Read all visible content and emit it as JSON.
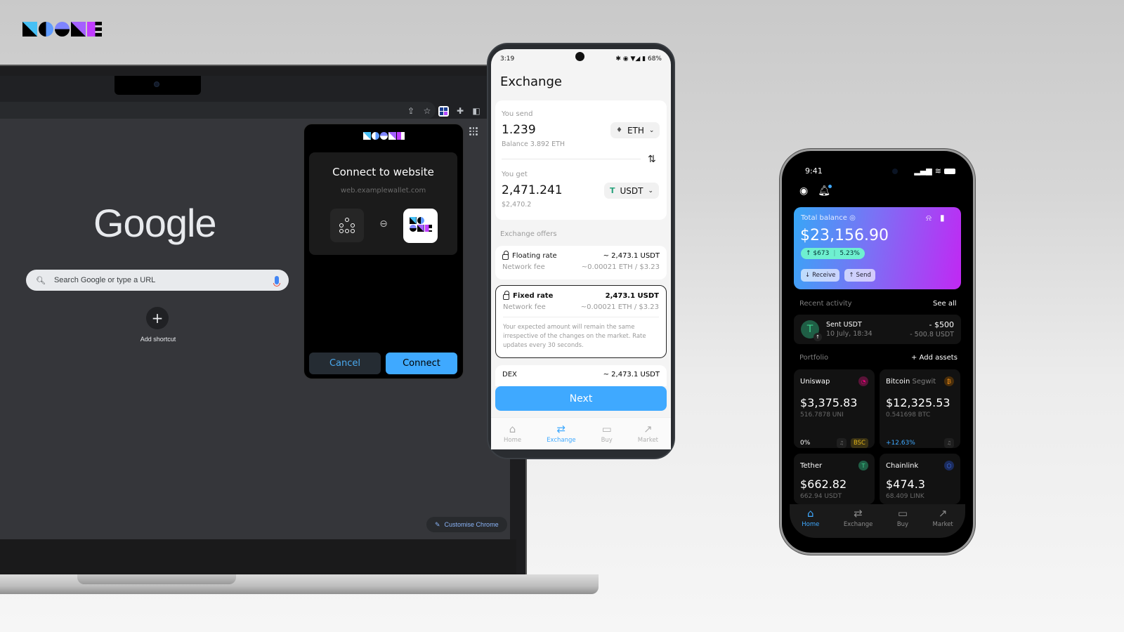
{
  "brand": {
    "name": "NOONE"
  },
  "browser": {
    "toolbar_icons": [
      "share-icon",
      "bookmark-star-icon",
      "noone-extension-icon",
      "extensions-puzzle-icon",
      "side-panel-icon",
      "profile-avatar"
    ],
    "new_tab": {
      "logo_text": "Google",
      "search_placeholder": "Search Google or type a URL",
      "add_shortcut_label": "Add shortcut",
      "customise_label": "Customise Chrome"
    }
  },
  "popup": {
    "title": "Connect to website",
    "url": "web.examplewallet.com",
    "cancel_label": "Cancel",
    "connect_label": "Connect"
  },
  "android": {
    "status": {
      "time": "3:19",
      "battery": "68%"
    },
    "title": "Exchange",
    "send": {
      "label": "You send",
      "amount": "1.239",
      "balance": "Balance 3.892 ETH",
      "token": "ETH"
    },
    "get": {
      "label": "You get",
      "amount": "2,471.241",
      "usd": "$2,470.2",
      "token": "USDT"
    },
    "offers_label": "Exchange offers",
    "offers": [
      {
        "name": "Floating rate",
        "amount": "~ 2,473.1 USDT",
        "fee_label": "Network fee",
        "fee": "~0.00021 ETH / $3.23"
      },
      {
        "name": "Fixed rate",
        "amount": "2,473.1 USDT",
        "fee_label": "Network fee",
        "fee": "~0.00021 ETH / $3.23",
        "note": "Your expected amount will remain the same irrespective of the changes on the market. Rate updates every 30 seconds."
      },
      {
        "name": "DEX",
        "amount": "~ 2,473.1 USDT"
      }
    ],
    "next_label": "Next",
    "nav": [
      {
        "label": "Home",
        "icon": "home-icon"
      },
      {
        "label": "Exchange",
        "icon": "exchange-icon",
        "active": true
      },
      {
        "label": "Buy",
        "icon": "card-icon"
      },
      {
        "label": "Market",
        "icon": "market-chart-icon"
      }
    ]
  },
  "iphone": {
    "status": {
      "time": "9:41"
    },
    "balance": {
      "label": "Total balance",
      "value": "$23,156.90",
      "change_amount": "↑ $673",
      "change_pct": "5.23%",
      "receive_label": "Receive",
      "send_label": "Send"
    },
    "recent_activity": {
      "label": "Recent activity",
      "see_all": "See all",
      "item": {
        "title": "Sent USDT",
        "date": "10 July, 18:34",
        "usd": "- $500",
        "amount": "- 500.8 USDT"
      }
    },
    "portfolio": {
      "label": "Portfolio",
      "add_label": "+ Add assets",
      "assets": [
        {
          "name": "Uniswap",
          "sub": "",
          "value": "$3,375.83",
          "qty": "516.7878 UNI",
          "change": "0%",
          "network": "BSC",
          "coin_color": "#e6007a"
        },
        {
          "name": "Bitcoin",
          "sub": "Segwit",
          "value": "$12,325.53",
          "qty": "0.541698 BTC",
          "change": "+12.63%",
          "network": "",
          "coin_color": "#f7931a"
        },
        {
          "name": "Tether",
          "sub": "",
          "value": "$662.82",
          "qty": "662.94 USDT",
          "coin_color": "#26a17b"
        },
        {
          "name": "Chainlink",
          "sub": "",
          "value": "$474.3",
          "qty": "68.409 LINK",
          "coin_color": "#2a5ada"
        }
      ]
    },
    "nav": [
      {
        "label": "Home",
        "active": true
      },
      {
        "label": "Exchange"
      },
      {
        "label": "Buy"
      },
      {
        "label": "Market"
      }
    ]
  }
}
